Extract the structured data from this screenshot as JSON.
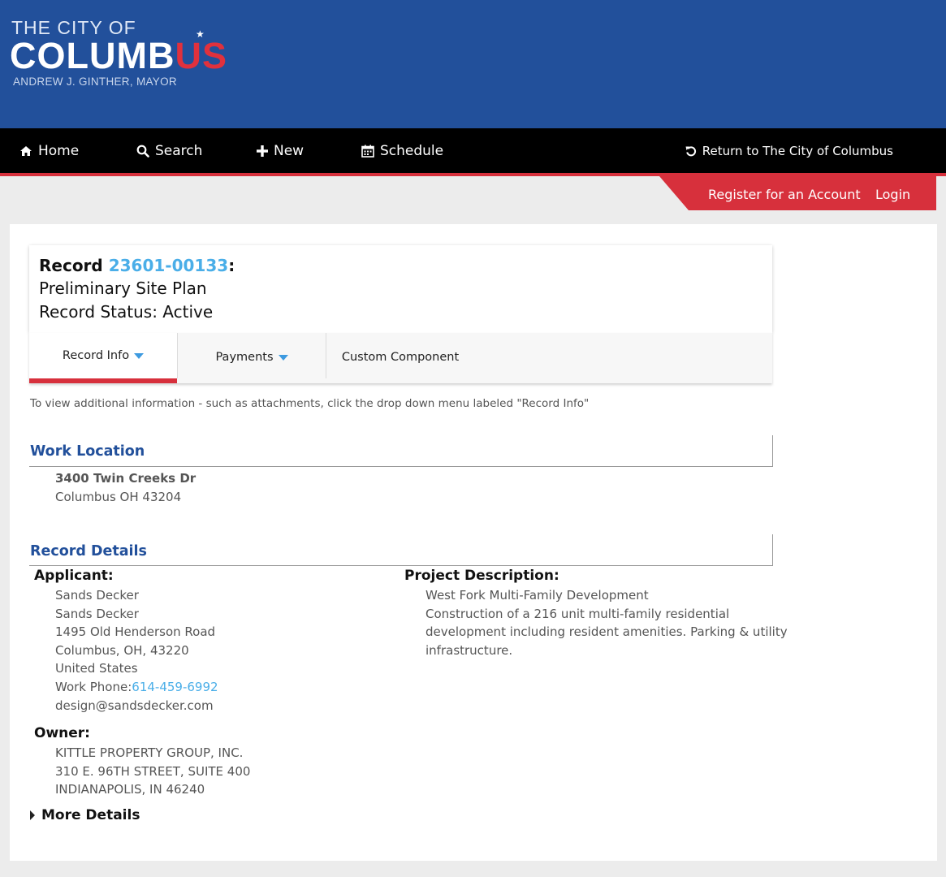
{
  "header": {
    "logo_line1": "THE CITY OF",
    "logo_line2_a": "COLUMB",
    "logo_line2_b": "US",
    "logo_line3": "ANDREW J. GINTHER, MAYOR"
  },
  "nav": {
    "home": "Home",
    "search": "Search",
    "new": "New",
    "schedule": "Schedule",
    "return": "Return to The City of Columbus"
  },
  "account": {
    "register": "Register for an Account",
    "login": "Login"
  },
  "record": {
    "label": "Record",
    "number": "23601-00133",
    "colon": ":",
    "type": "Preliminary Site Plan",
    "status": "Record Status: Active"
  },
  "tabs": {
    "record_info": "Record Info",
    "payments": "Payments",
    "custom": "Custom Component"
  },
  "hint": "To view additional information - such as attachments, click the drop down menu labeled \"Record Info\"",
  "work_location": {
    "title": "Work Location",
    "line1": "3400 Twin Creeks Dr",
    "line2": "Columbus OH 43204"
  },
  "record_details": {
    "title": "Record Details",
    "applicant_label": "Applicant:",
    "applicant": {
      "name1": "Sands Decker",
      "name2": "Sands Decker",
      "address": "1495 Old Henderson Road",
      "city": "Columbus, OH, 43220",
      "country": "United States",
      "phone_label": "Work Phone:",
      "phone": "614-459-6992",
      "email": "design@sandsdecker.com"
    },
    "owner_label": "Owner:",
    "owner": {
      "name": "KITTLE PROPERTY GROUP, INC.",
      "address": "310 E. 96TH STREET, SUITE 400",
      "city": "INDIANAPOLIS, IN 46240"
    },
    "project_label": "Project Description:",
    "project": {
      "title": "West Fork Multi-Family Development",
      "line1": "Construction of a 216 unit multi-family residential",
      "line2": "development including resident amenities. Parking & utility",
      "line3": "infrastructure."
    },
    "more_details": "More Details"
  },
  "colors": {
    "header_blue": "#22509b",
    "accent_red": "#d7303c",
    "link_blue": "#4aaee8"
  }
}
